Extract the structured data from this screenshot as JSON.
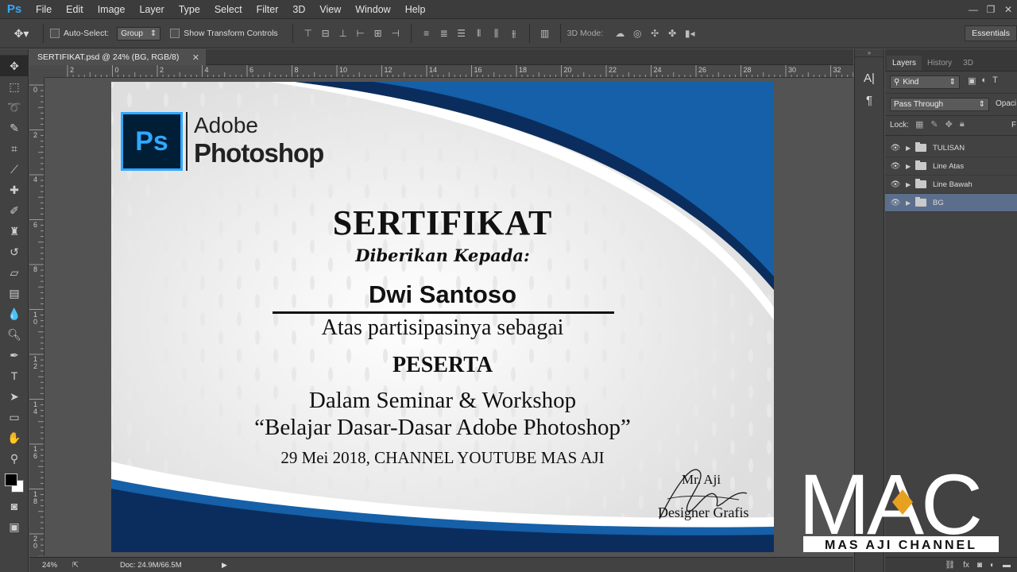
{
  "menubar": {
    "logo": "Ps",
    "items": [
      "File",
      "Edit",
      "Image",
      "Layer",
      "Type",
      "Select",
      "Filter",
      "3D",
      "View",
      "Window",
      "Help"
    ]
  },
  "options": {
    "auto_select_label": "Auto-Select:",
    "auto_select_value": "Group",
    "show_transform_label": "Show Transform Controls",
    "mode_3d_label": "3D Mode:",
    "workspace": "Essentials"
  },
  "document": {
    "tab_title": "SERTIFIKAT.psd @ 24% (BG, RGB/8)",
    "ruler_top": [
      "2",
      "0",
      "2",
      "4",
      "6",
      "8",
      "10",
      "12",
      "14",
      "16",
      "18",
      "20",
      "22",
      "24",
      "26",
      "28",
      "30",
      "32"
    ],
    "ruler_left": [
      "0",
      "2",
      "4",
      "6",
      "8",
      "10",
      "12",
      "14",
      "16",
      "18",
      "20"
    ],
    "zoom": "24%",
    "doc_size": "Doc: 24.9M/66.5M"
  },
  "certificate": {
    "logo_mark": "Ps",
    "logo_line1": "Adobe",
    "logo_line2": "Photoshop",
    "title": "SERTIFIKAT",
    "given_to": "Diberikan Kepada:",
    "name": "Dwi Santoso",
    "line1": "Atas partisipasinya sebagai",
    "role": "PESERTA",
    "event_line1": "Dalam Seminar & Workshop",
    "event_line2": "“Belajar Dasar-Dasar Adobe Photoshop”",
    "date_line": "29 Mei 2018, CHANNEL YOUTUBE MAS AJI",
    "signer_name": "Mr. Aji",
    "signer_title": "Designer Grafis"
  },
  "panels": {
    "tabs": [
      "Layers",
      "History",
      "3D"
    ],
    "filter_kind": "Kind",
    "blend_mode": "Pass Through",
    "opacity_label": "Opaci",
    "lock_label": "Lock:",
    "fill_label": "F",
    "layers": [
      {
        "name": "TULISAN",
        "selected": false
      },
      {
        "name": "Line Atas",
        "selected": false
      },
      {
        "name": "Line Bawah",
        "selected": false
      },
      {
        "name": "BG",
        "selected": true
      }
    ]
  },
  "watermark": {
    "logo": "MAC",
    "caption": "MAS AJI CHANNEL"
  },
  "colors": {
    "ps_blue": "#31a8ff",
    "cert_navy": "#0b2d5e",
    "cert_blue": "#1560a8",
    "layer_selected": "#5b6e8c",
    "mac_accent": "#e8a020"
  }
}
